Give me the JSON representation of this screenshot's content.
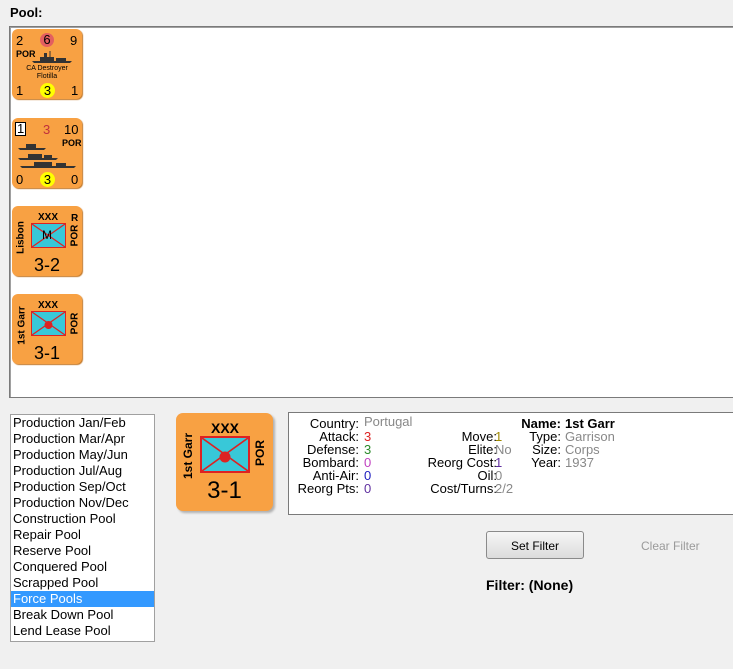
{
  "pool": {
    "label": "Pool:",
    "counters": [
      {
        "type": "naval",
        "top_left": "2",
        "top_center": "6",
        "top_right": "9",
        "nation": "POR",
        "name_line1": "CA Destroyer",
        "name_line2": "Flotilla",
        "bottom_left": "1",
        "bottom_center": "3",
        "bottom_right": "1"
      },
      {
        "type": "naval2",
        "top_left": "1",
        "top_center": "3",
        "top_right": "10",
        "nation": "POR",
        "bottom_left": "0",
        "bottom_center": "3",
        "bottom_right": "0"
      },
      {
        "type": "land",
        "size": "XXX",
        "side_left": "Lisbon",
        "side_right": "POR",
        "corner": "R",
        "unit_symbol": "M",
        "strength": "3-2"
      },
      {
        "type": "land",
        "size": "XXX",
        "side_left": "1st Garr",
        "side_right": "POR",
        "strength": "3-1"
      }
    ]
  },
  "list": {
    "items": [
      "Production Jan/Feb",
      "Production Mar/Apr",
      "Production May/Jun",
      "Production Jul/Aug",
      "Production Sep/Oct",
      "Production Nov/Dec",
      "Construction Pool",
      "Repair Pool",
      "Reserve Pool",
      "Conquered Pool",
      "Scrapped Pool",
      "Force Pools",
      "Break Down Pool",
      "Lend Lease Pool"
    ],
    "selected_index": 11
  },
  "selected_counter": {
    "size": "XXX",
    "side_left": "1st Garr",
    "side_right": "POR",
    "strength": "3-1"
  },
  "info": {
    "country_label": "Country:",
    "country": "Portugal",
    "attack_label": "Attack:",
    "attack": "3",
    "defense_label": "Defense:",
    "defense": "3",
    "bombard_label": "Bombard:",
    "bombard": "0",
    "antiair_label": "Anti-Air:",
    "antiair": "0",
    "reorgpts_label": "Reorg Pts:",
    "reorgpts": "0",
    "move_label": "Move:",
    "move": "1",
    "elite_label": "Elite:",
    "elite": "No",
    "reorgcost_label": "Reorg Cost:",
    "reorgcost": "1",
    "oil_label": "Oil:",
    "oil": "0",
    "costturns_label": "Cost/Turns:",
    "costturns": "2/2",
    "name_label": "Name:",
    "name": "1st Garr",
    "type_label": "Type:",
    "type": "Garrison",
    "size_label": "Size:",
    "size": "Corps",
    "year_label": "Year:",
    "year": "1937"
  },
  "controls": {
    "set_filter": "Set Filter",
    "clear_filter": "Clear Filter",
    "filter_status": "Filter: (None)"
  },
  "colors": {
    "counter": "#f8a143",
    "unit_box": "#38c8d8",
    "selected": "#3399ff"
  }
}
